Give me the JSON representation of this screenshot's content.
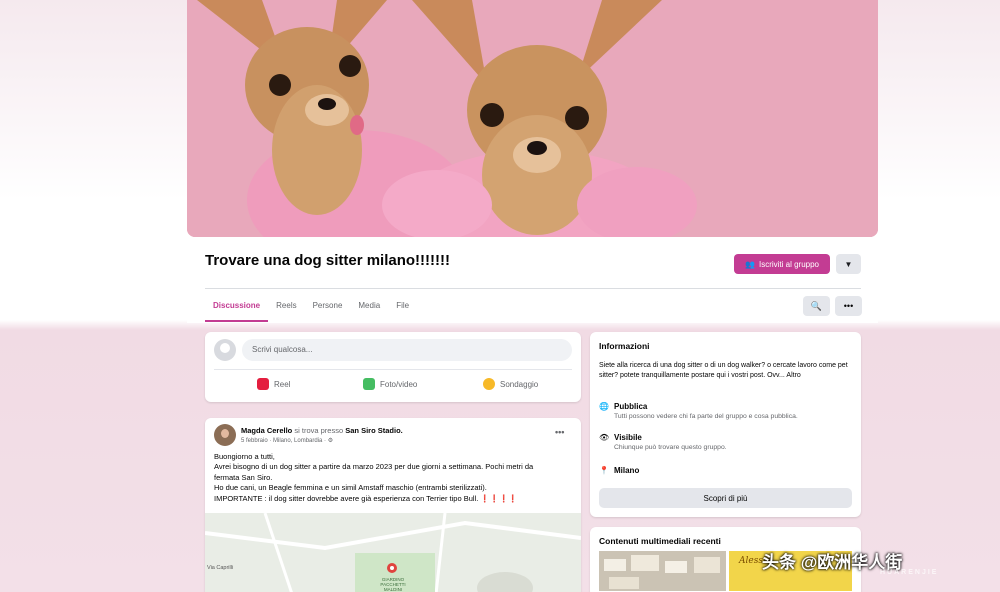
{
  "group": {
    "title": "Trovare una dog sitter milano!!!!!!!",
    "join_label": "Iscriviti al gruppo"
  },
  "tabs": [
    {
      "label": "Discussione",
      "active": true
    },
    {
      "label": "Reels"
    },
    {
      "label": "Persone"
    },
    {
      "label": "Media"
    },
    {
      "label": "File"
    }
  ],
  "composer": {
    "placeholder": "Scrivi qualcosa...",
    "actions": [
      {
        "label": "Reel",
        "icon": "reel-icon",
        "color": "#e41e3f"
      },
      {
        "label": "Foto/video",
        "icon": "photo-icon",
        "color": "#45bd62"
      },
      {
        "label": "Sondaggio",
        "icon": "poll-icon",
        "color": "#f7b928"
      }
    ]
  },
  "post": {
    "author": "Magda Cerello",
    "location_prefix": "si trova presso",
    "location": "San Siro Stadio.",
    "meta": "5 febbraio · Milano, Lombardia · ⚙",
    "lines": [
      "Buongiorno a tutti,",
      "Avrei bisogno di un dog sitter a partire da marzo 2023 per due giorni a settimana. Pochi metri da",
      "fermata San Siro.",
      "Ho due cani, un Beagle femmina e un simil Amstaff maschio (entrambi sterilizzati).",
      "IMPORTANTE : il dog sitter dovrebbe avere già esperienza con Terrier tipo Bull. ❗❗❗❗"
    ],
    "map_labels": [
      "Via Caprilli",
      "GIARDINO PACCHETTI MALDINI"
    ]
  },
  "info": {
    "heading": "Informazioni",
    "description": "Siete alla ricerca di una dog sitter o di un dog walker? o cercate lavoro come pet sitter? potete tranquillamente postare qui i vostri post. Ovv... Altro",
    "public_title": "Pubblica",
    "public_sub": "Tutti possono vedere chi fa parte del gruppo e cosa pubblica.",
    "visible_title": "Visibile",
    "visible_sub": "Chiunque può trovare questo gruppo.",
    "location": "Milano",
    "more_label": "Scopri di più"
  },
  "media": {
    "heading": "Contenuti multimediali recenti",
    "thumb_text": "Alessia"
  },
  "watermark": {
    "text": "头条 @欧洲华人街",
    "sub": "HUARENJIE"
  },
  "colors": {
    "accent": "#c33c93",
    "cover_bg": "#e7a6ba"
  }
}
